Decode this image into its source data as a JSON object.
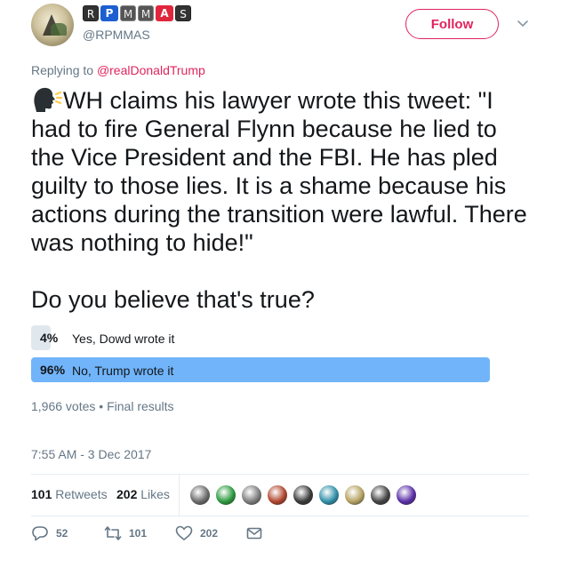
{
  "author": {
    "display_name_boxes": [
      "R",
      "P",
      "M",
      "M",
      "A",
      "S"
    ],
    "handle": "@RPMMAS",
    "avatar_icon": "avatar-image"
  },
  "follow_label": "Follow",
  "reply_to": {
    "prefix": "Replying to",
    "user": "@realDonaldTrump"
  },
  "tweet": {
    "emoji_icon": "speaking-head-icon",
    "body": "WH claims his lawyer wrote this tweet: \"I had to fire General Flynn because he lied to the Vice President and the FBI. He has pled guilty to those lies. It is a shame because his actions during the transition were lawful. There was nothing to hide!\"\n\nDo you believe that's true?"
  },
  "poll": {
    "options": [
      {
        "percent": "4%",
        "label": "Yes, Dowd wrote it",
        "share": 0.04
      },
      {
        "percent": "96%",
        "label": "No, Trump wrote it",
        "share": 0.96
      }
    ],
    "votes": "1,966 votes",
    "separator": "•",
    "status": "Final results"
  },
  "timestamp": "7:55 AM - 3 Dec 2017",
  "stats": {
    "retweets_count": "101",
    "retweets_label": "Retweets",
    "likes_count": "202",
    "likes_label": "Likes"
  },
  "liker_avatars": [
    "#6b6b6b",
    "#2c9a3e",
    "#7d7d7d",
    "#b0452c",
    "#3a3a3a",
    "#2f8fa8",
    "#b5a262",
    "#444444",
    "#5a2fa6"
  ],
  "actions": {
    "reply_count": "52",
    "retweet_count": "101",
    "like_count": "202"
  },
  "colors": {
    "accent": "#e0245e",
    "poll_winner": "#71b4f9",
    "poll_other": "#e1e8ed",
    "muted": "#657786"
  }
}
